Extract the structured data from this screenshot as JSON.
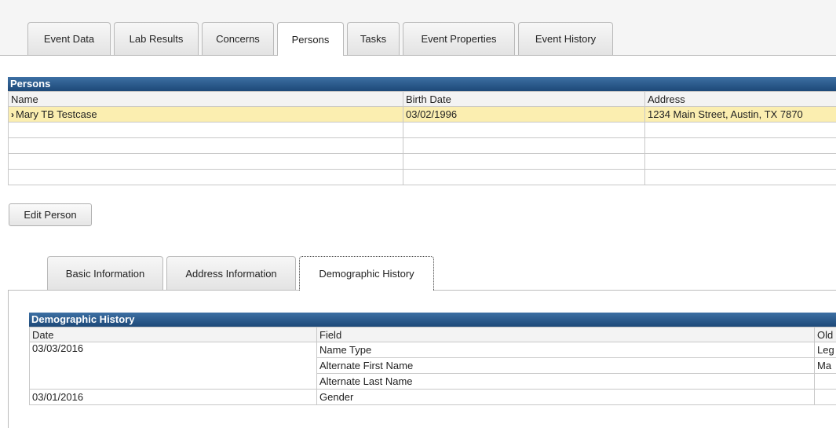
{
  "top_tabs": [
    "Event Data",
    "Lab Results",
    "Concerns",
    "Persons",
    "Tasks",
    "Event Properties",
    "Event History"
  ],
  "active_top_tab": "Persons",
  "persons": {
    "title": "Persons",
    "columns": [
      "Name",
      "Birth Date",
      "Address"
    ],
    "rows": [
      {
        "name": "Mary TB Testcase",
        "birth_date": "03/02/1996",
        "address": "1234 Main Street, Austin, TX 7870"
      }
    ]
  },
  "edit_person_label": "Edit Person",
  "sub_tabs": [
    "Basic Information",
    "Address Information",
    "Demographic History"
  ],
  "active_sub_tab": "Demographic History",
  "demographic_history": {
    "title": "Demographic History",
    "columns": [
      "Date",
      "Field",
      "Old"
    ],
    "rows": [
      {
        "date": "03/03/2016",
        "field": "Name Type",
        "old": "Leg"
      },
      {
        "date": "",
        "field": "Alternate First Name",
        "old": "Ma"
      },
      {
        "date": "",
        "field": "Alternate Last Name",
        "old": ""
      },
      {
        "date": "03/01/2016",
        "field": "Gender",
        "old": ""
      }
    ]
  }
}
